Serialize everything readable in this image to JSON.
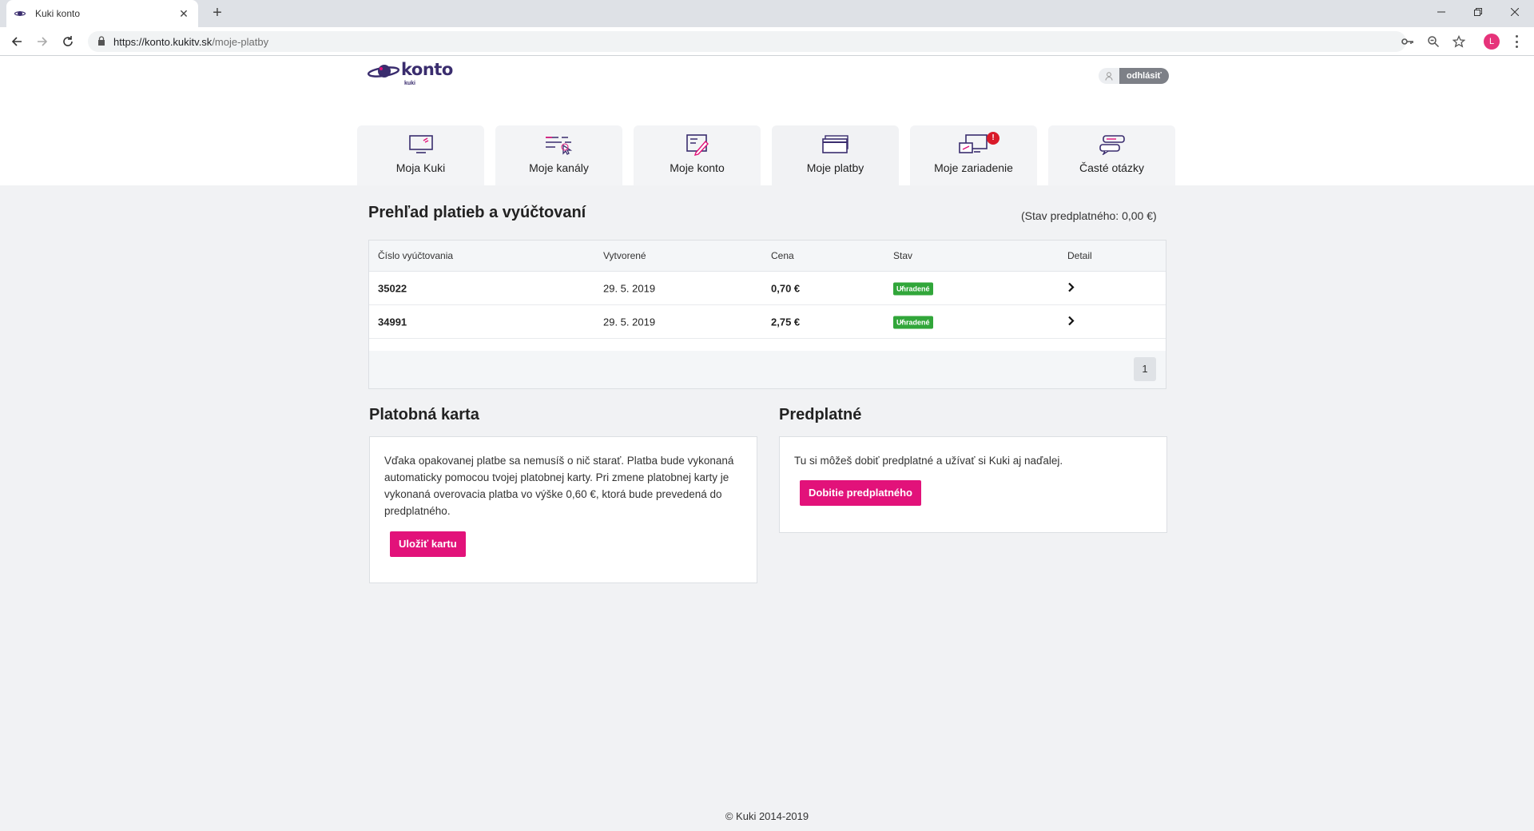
{
  "browser": {
    "tab_title": "Kuki konto",
    "tab_close": "✕",
    "new_tab": "+",
    "url_main": "https://konto.kukitv.sk",
    "url_path": "/moje-platby",
    "profile_initial": "L"
  },
  "header": {
    "logo_word": "konto",
    "logo_sub": "kuki",
    "logout_label": "odhlásiť"
  },
  "nav": {
    "items": [
      {
        "label": "Moja Kuki",
        "icon": "monitor-icon"
      },
      {
        "label": "Moje kanály",
        "icon": "channel-list-icon"
      },
      {
        "label": "Moje konto",
        "icon": "account-edit-icon"
      },
      {
        "label": "Moje platby",
        "icon": "payment-cards-icon"
      },
      {
        "label": "Moje zariadenie",
        "icon": "devices-icon",
        "alert": "!"
      },
      {
        "label": "Časté otázky",
        "icon": "chat-bubbles-icon"
      }
    ]
  },
  "main": {
    "title": "Prehľad platieb a vyúčtovaní",
    "balance": "(Stav predplatného: 0,00 €)",
    "table": {
      "headers": [
        "Číslo vyúčtovania",
        "Vytvorené",
        "Cena",
        "Stav",
        "Detail"
      ],
      "rows": [
        {
          "number": "35022",
          "created": "29. 5. 2019",
          "price": "0,70 €",
          "status": "Uhradené"
        },
        {
          "number": "34991",
          "created": "29. 5. 2019",
          "price": "2,75 €",
          "status": "Uhradené"
        }
      ],
      "page": "1"
    }
  },
  "card_section": {
    "title": "Platobná karta",
    "text": "Vďaka opakovanej platbe sa nemusíš o nič starať. Platba bude vykonaná automaticky pomocou tvojej platobnej karty. Pri zmene platobnej karty je vykonaná overovacia platba vo výške 0,60 €, ktorá bude prevedená do predplatného.",
    "button": "Uložiť kartu"
  },
  "subscription_section": {
    "title": "Predplatné",
    "text": "Tu si môžeš dobiť predplatné a užívať si Kuki aj naďalej.",
    "button": "Dobitie predplatného"
  },
  "footer": {
    "copyright": "© Kuki 2014-2019"
  },
  "colors": {
    "accent": "#e2127a",
    "brand": "#3a2d6e",
    "status_paid": "#31a63a",
    "alert": "#d91a2a"
  }
}
